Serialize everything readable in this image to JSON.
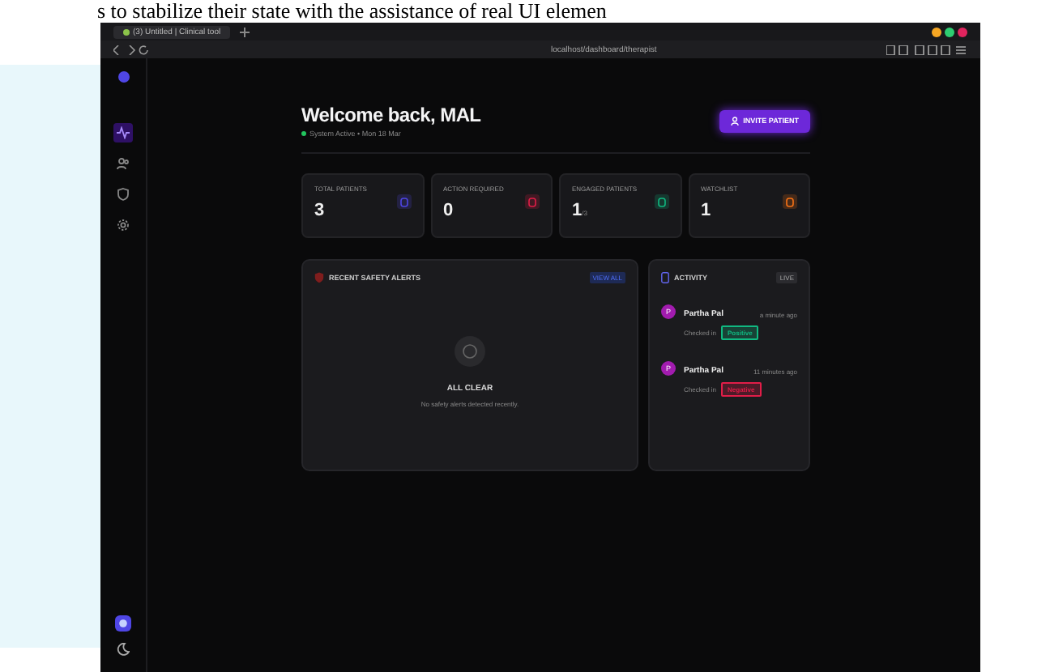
{
  "caption": "s to stabilize their state with the assistance of real UI elemen",
  "browser": {
    "tabs": [
      {
        "label": "(3) Untitled | Clinical tool",
        "selected": true
      }
    ],
    "url": "localhost/dashboard/therapist"
  },
  "sidebar": {
    "items": [
      {
        "kind": "pulse",
        "selected": true
      },
      {
        "kind": "people",
        "selected": false
      },
      {
        "kind": "shield",
        "selected": false
      },
      {
        "kind": "gear",
        "selected": false
      }
    ]
  },
  "header": {
    "title": "Welcome back, MAL",
    "status": "System Active • Mon 18 Mar",
    "button": "INVITE PATIENT"
  },
  "stats": [
    {
      "label": "TOTAL PATIENTS",
      "value": "3",
      "color": "#4f46e5"
    },
    {
      "label": "ACTION REQUIRED",
      "value": "0",
      "color": "#e11d48"
    },
    {
      "label": "ENGAGED PATIENTS",
      "value": "1",
      "suffix": "/3",
      "color": "#10b981"
    },
    {
      "label": "WATCHLIST",
      "value": "1",
      "color": "#f97316"
    }
  ],
  "alerts": {
    "title": "RECENT SAFETY ALERTS",
    "link": "VIEW ALL",
    "empty_title": "ALL CLEAR",
    "empty_text": "No safety alerts detected recently."
  },
  "activity": {
    "title": "ACTIVITY",
    "badge": "LIVE",
    "items": [
      {
        "avatar": "P",
        "name": "Partha Pal",
        "time": "a minute ago",
        "action": "Checked in",
        "tag": "Positive",
        "color": "#10b981"
      },
      {
        "avatar": "P",
        "name": "Partha Pal",
        "time": "11 minutes ago",
        "action": "Checked in",
        "tag": "Negative",
        "color": "#e11d48"
      }
    ]
  }
}
